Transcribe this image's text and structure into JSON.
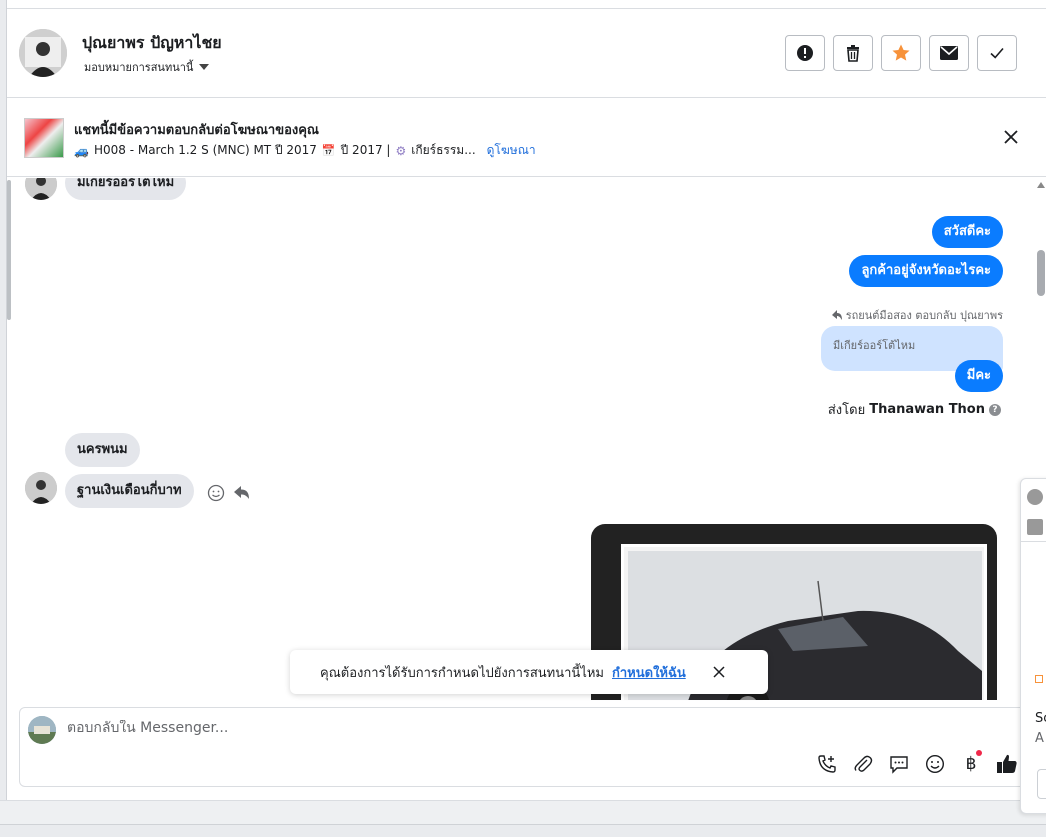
{
  "header": {
    "contact_name": "ปุณยาพร ปัญหาไชย",
    "assign_label": "มอบหมายการสนทนานี้"
  },
  "ad_banner": {
    "title": "แชทนี้มีข้อความตอบกลับต่อโฆษณาของคุณ",
    "details_1": "H008 - March 1.2 S (MNC) MT ปี 2017",
    "details_2": "ปี 2017 |",
    "details_3": "เกียร์ธรรม...",
    "view_ad_link": "ดูโฆษณา"
  },
  "messages": {
    "incoming_1": "มีเกียร์ออร์โต้ไหม",
    "outgoing_1": "สวัสดีคะ",
    "outgoing_2": "ลูกค้าอยู่จังหวัดอะไรคะ",
    "reply_meta": "รถยนต์มือสอง ตอบกลับ ปุณยาพร",
    "quoted_text": "มีเกียร์ออร์โต้ไหม",
    "outgoing_3": "มีคะ",
    "sent_by_label": "ส่งโดย",
    "sent_by_name": "Thanawan Thon",
    "help_glyph": "?",
    "incoming_2": "นครพนม",
    "incoming_3": "ฐานเงินเดือนกี่บาท"
  },
  "toast": {
    "text": "คุณต้องการได้รับการกำหนดไปยังการสนทนานี้ไหม",
    "link": "กำหนดให้ฉัน"
  },
  "composer": {
    "placeholder": "ตอบกลับใน Messenger...",
    "currency_glyph": "฿"
  },
  "side_popup": {
    "letter_1": "Sc",
    "letter_2": "A"
  },
  "colors": {
    "accent": "#0a7cff",
    "star": "#f7923a",
    "link": "#216fdb"
  }
}
